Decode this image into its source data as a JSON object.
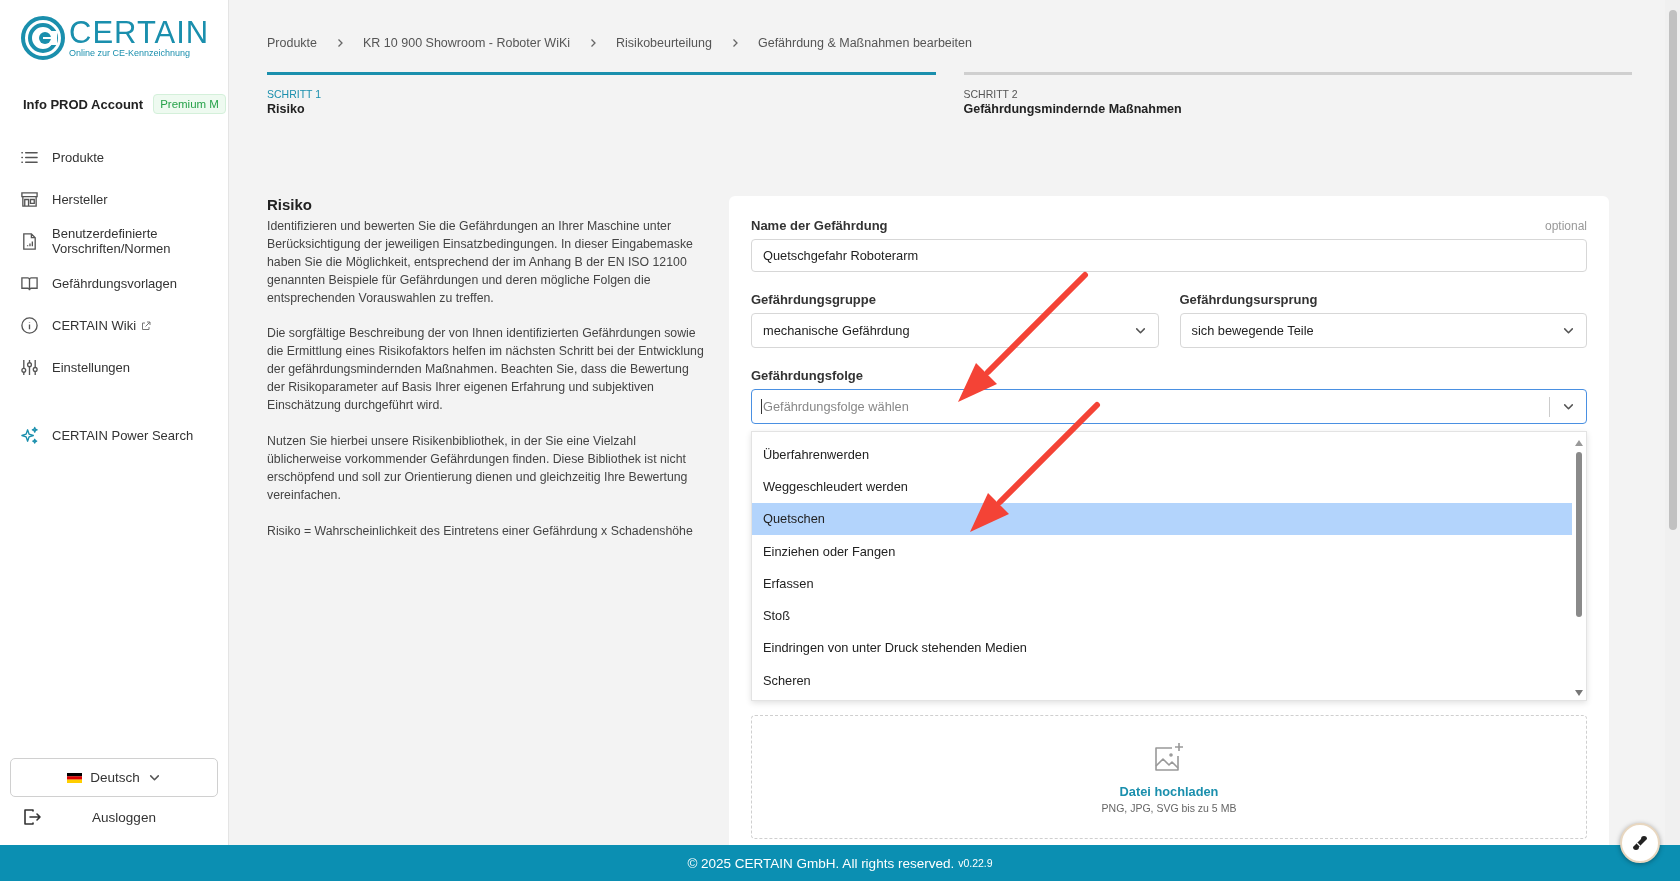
{
  "logo": {
    "name": "CERTAIN",
    "tagline": "Online zur CE-Kennzeichnung"
  },
  "account": {
    "name": "Info PROD Account",
    "badge": "Premium M"
  },
  "nav": [
    {
      "label": "Produkte",
      "kind": "list"
    },
    {
      "label": "Hersteller",
      "kind": "store"
    },
    {
      "label": "Benutzerdefinierte Vorschriften/Normen",
      "kind": "document"
    },
    {
      "label": "Gefährdungsvorlagen",
      "kind": "book"
    },
    {
      "label": "CERTAIN Wiki",
      "kind": "info",
      "external": true
    },
    {
      "label": "Einstellungen",
      "kind": "sliders"
    }
  ],
  "power_search": {
    "label": "CERTAIN Power Search"
  },
  "language": {
    "label": "Deutsch"
  },
  "logout": {
    "label": "Ausloggen"
  },
  "breadcrumb": [
    "Produkte",
    "KR 10 900 Showroom - Roboter WiKi",
    "Risikobeurteilung",
    "Gefährdung & Maßnahmen bearbeiten"
  ],
  "steps": [
    {
      "label": "SCHRITT 1",
      "title": "Risiko",
      "selected": true
    },
    {
      "label": "SCHRITT 2",
      "title": "Gefährdungsmindernde Maßnahmen",
      "selected": false
    }
  ],
  "intro": {
    "title": "Risiko",
    "paragraphs": [
      "Identifizieren und bewerten Sie die Gefährdungen an Ihrer Maschine unter Berücksichtigung der jeweiligen Einsatzbedingungen. In dieser Eingabemaske haben Sie die Möglichkeit, entsprechend der im Anhang B der EN ISO 12100 genannten Beispiele für Gefährdungen und deren mögliche Folgen die entsprechenden Vorauswahlen zu treffen.",
      "Die sorgfältige Beschreibung der von Ihnen identifizierten Gefährdungen sowie die Ermittlung eines Risikofaktors helfen im nächsten Schritt bei der Entwicklung der gefährdungsmindernden Maßnahmen. Beachten Sie, dass die Bewertung der Risikoparameter auf Basis Ihrer eigenen Erfahrung und subjektiven Einschätzung durchgeführt wird.",
      "Nutzen Sie hierbei unsere Risikenbibliothek, in der Sie eine Vielzahl üblicherweise vorkommender Gefährdungen finden. Diese Bibliothek ist nicht erschöpfend und soll zur Orientierung dienen und gleichzeitig Ihre Bewertung vereinfachen.",
      "Risiko = Wahrscheinlichkeit des Eintretens einer Gefährdung x Schadenshöhe"
    ]
  },
  "form": {
    "name_field": {
      "label": "Name der Gefährdung",
      "hint": "optional",
      "value": "Quetschgefahr Roboterarm"
    },
    "group": {
      "label": "Gefährdungsgruppe",
      "value": "mechanische Gefährdung"
    },
    "origin": {
      "label": "Gefährdungsursprung",
      "value": "sich bewegende Teile"
    },
    "consequence": {
      "label": "Gefährdungsfolge",
      "placeholder": "Gefährdungsfolge wählen",
      "expanded": true,
      "options": [
        {
          "label": "Überfahrenwerden",
          "selected": false
        },
        {
          "label": "Weggeschleudert werden",
          "selected": false
        },
        {
          "label": "Quetschen",
          "selected": true
        },
        {
          "label": "Einziehen oder Fangen",
          "selected": false
        },
        {
          "label": "Erfassen",
          "selected": false
        },
        {
          "label": "Stoß",
          "selected": false
        },
        {
          "label": "Eindringen von unter Druck stehenden Medien",
          "selected": false
        },
        {
          "label": "Scheren",
          "selected": false
        }
      ]
    },
    "upload": {
      "action": "Datei hochladen",
      "hint": "PNG, JPG, SVG bis zu 5 MB"
    }
  },
  "footer": {
    "copyright": "© 2025 CERTAIN GmbH. All rights reserved.",
    "version": "v0.22.9"
  }
}
